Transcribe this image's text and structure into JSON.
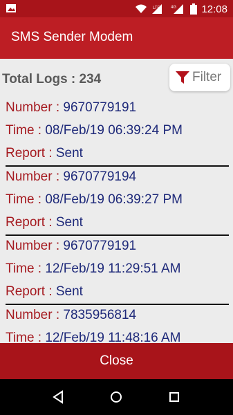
{
  "status_bar": {
    "time": "12:08",
    "icons": [
      "image-icon",
      "wifi-icon",
      "lte-icon",
      "signal-4g-icon",
      "battery-icon"
    ],
    "lte_label": "LTE",
    "signal_label": "4G"
  },
  "app_bar": {
    "title": "SMS Sender Modem"
  },
  "summary": {
    "total_logs_label": "Total Logs : 234"
  },
  "filter": {
    "label": "Filter",
    "icon": "funnel-icon"
  },
  "labels": {
    "number": "Number : ",
    "time": "Time : ",
    "report": "Report : "
  },
  "logs": [
    {
      "number": "9670779191",
      "time": "08/Feb/19 06:39:24 PM",
      "report": "Sent"
    },
    {
      "number": "9670779194",
      "time": "08/Feb/19 06:39:27 PM",
      "report": "Sent"
    },
    {
      "number": "9670779191",
      "time": "12/Feb/19 11:29:51 AM",
      "report": "Sent"
    },
    {
      "number": "7835956814",
      "time": "12/Feb/19 11:48:16 AM",
      "report": ""
    }
  ],
  "close_button": {
    "label": "Close"
  },
  "nav": {
    "back": "back-icon",
    "home": "home-icon",
    "recents": "recents-icon"
  },
  "colors": {
    "status_bar": "#a8141a",
    "app_bar": "#bd1e24",
    "key_text": "#a51a20",
    "value_text": "#1f2a7a"
  }
}
